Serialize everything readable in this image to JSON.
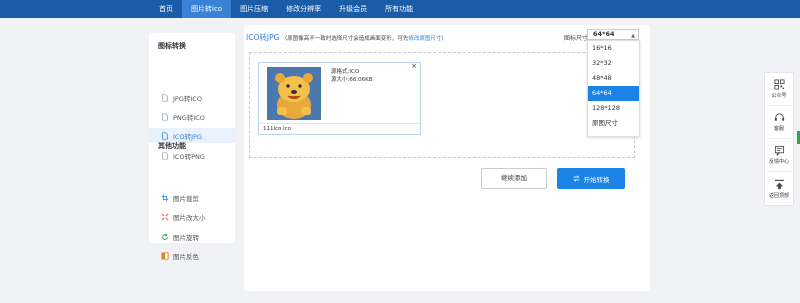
{
  "nav": {
    "items": [
      {
        "label": "首页",
        "active": false
      },
      {
        "label": "图片转ico",
        "active": true
      },
      {
        "label": "图片压缩",
        "active": false
      },
      {
        "label": "修改分辨率",
        "active": false
      },
      {
        "label": "升级会员",
        "active": false
      },
      {
        "label": "所有功能",
        "active": false
      }
    ]
  },
  "sidebar": {
    "section1_title": "图标转换",
    "items": [
      {
        "label": "JPG转ICO",
        "icon": "file-icon",
        "active": false
      },
      {
        "label": "PNG转ICO",
        "icon": "file-icon",
        "active": false
      },
      {
        "label": "ICO转JPG",
        "icon": "file-icon",
        "active": true
      },
      {
        "label": "ICO转PNG",
        "icon": "file-icon",
        "active": false
      }
    ],
    "section2_title": "其他功能",
    "other_items": [
      {
        "label": "图片裁剪",
        "icon": "crop-icon"
      },
      {
        "label": "图片改大小",
        "icon": "resize-icon"
      },
      {
        "label": "图片旋转",
        "icon": "rotate-icon"
      },
      {
        "label": "图片反色",
        "icon": "invert-icon"
      }
    ]
  },
  "main": {
    "title": "ICO转JPG",
    "note_prefix": "（原图像高不一致时选择尺寸会造成画面变形，可先",
    "note_link": "修改原图尺寸",
    "note_suffix": "）",
    "size_label": "图标尺寸",
    "size_selected": "64*64",
    "file": {
      "info_format": "源格式:ICO",
      "info_size": "源大小:66.06KB",
      "name": "111ico.ico",
      "close": "×"
    },
    "continue_button": "继续添加",
    "start_button": "开始转换"
  },
  "dropdown": {
    "options": [
      "16*16",
      "32*32",
      "48*48",
      "64*64",
      "128*128",
      "原图尺寸"
    ],
    "selected_index": 3
  },
  "floatbar": {
    "items": [
      {
        "label": "公众号",
        "icon": "qrcode-icon"
      },
      {
        "label": "客服",
        "icon": "headset-icon"
      },
      {
        "label": "反馈中心",
        "icon": "feedback-icon"
      },
      {
        "label": "返回顶部",
        "icon": "back-to-top-icon"
      }
    ]
  },
  "colors": {
    "nav_bg": "#1b5ca8",
    "accent": "#1b82e6",
    "link": "#2f7fdf"
  }
}
